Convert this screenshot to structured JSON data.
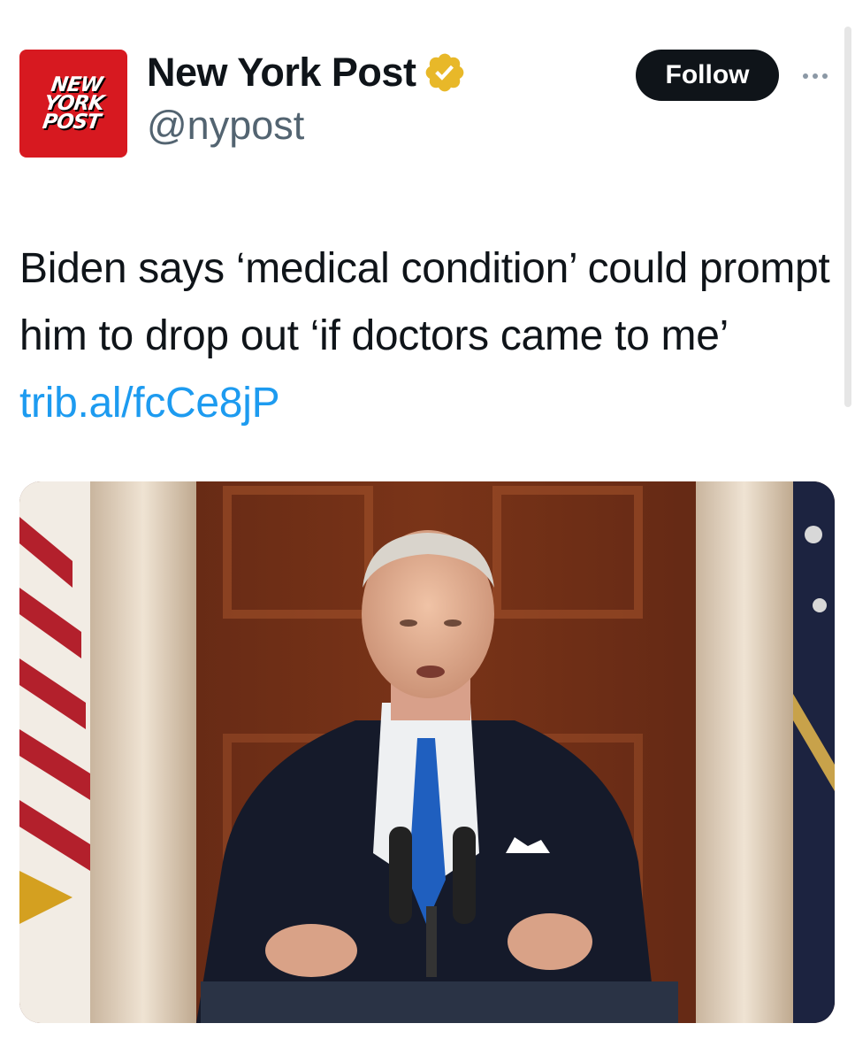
{
  "author": {
    "display_name": "New York Post",
    "handle": "@nypost",
    "avatar_lines": [
      "NEW",
      "YORK",
      "POST"
    ],
    "verified_badge": "gold-check-icon",
    "brand_color": "#d71920",
    "verified_color": "#e8b829"
  },
  "actions": {
    "follow_label": "Follow",
    "more_icon": "more-icon"
  },
  "post": {
    "text": "Biden says ‘medical condition’ could prompt him to drop out ‘if doctors came to me’ ",
    "link": "trib.al/fcCe8jP",
    "link_color": "#1d9bf0"
  },
  "media": {
    "type": "photo"
  }
}
